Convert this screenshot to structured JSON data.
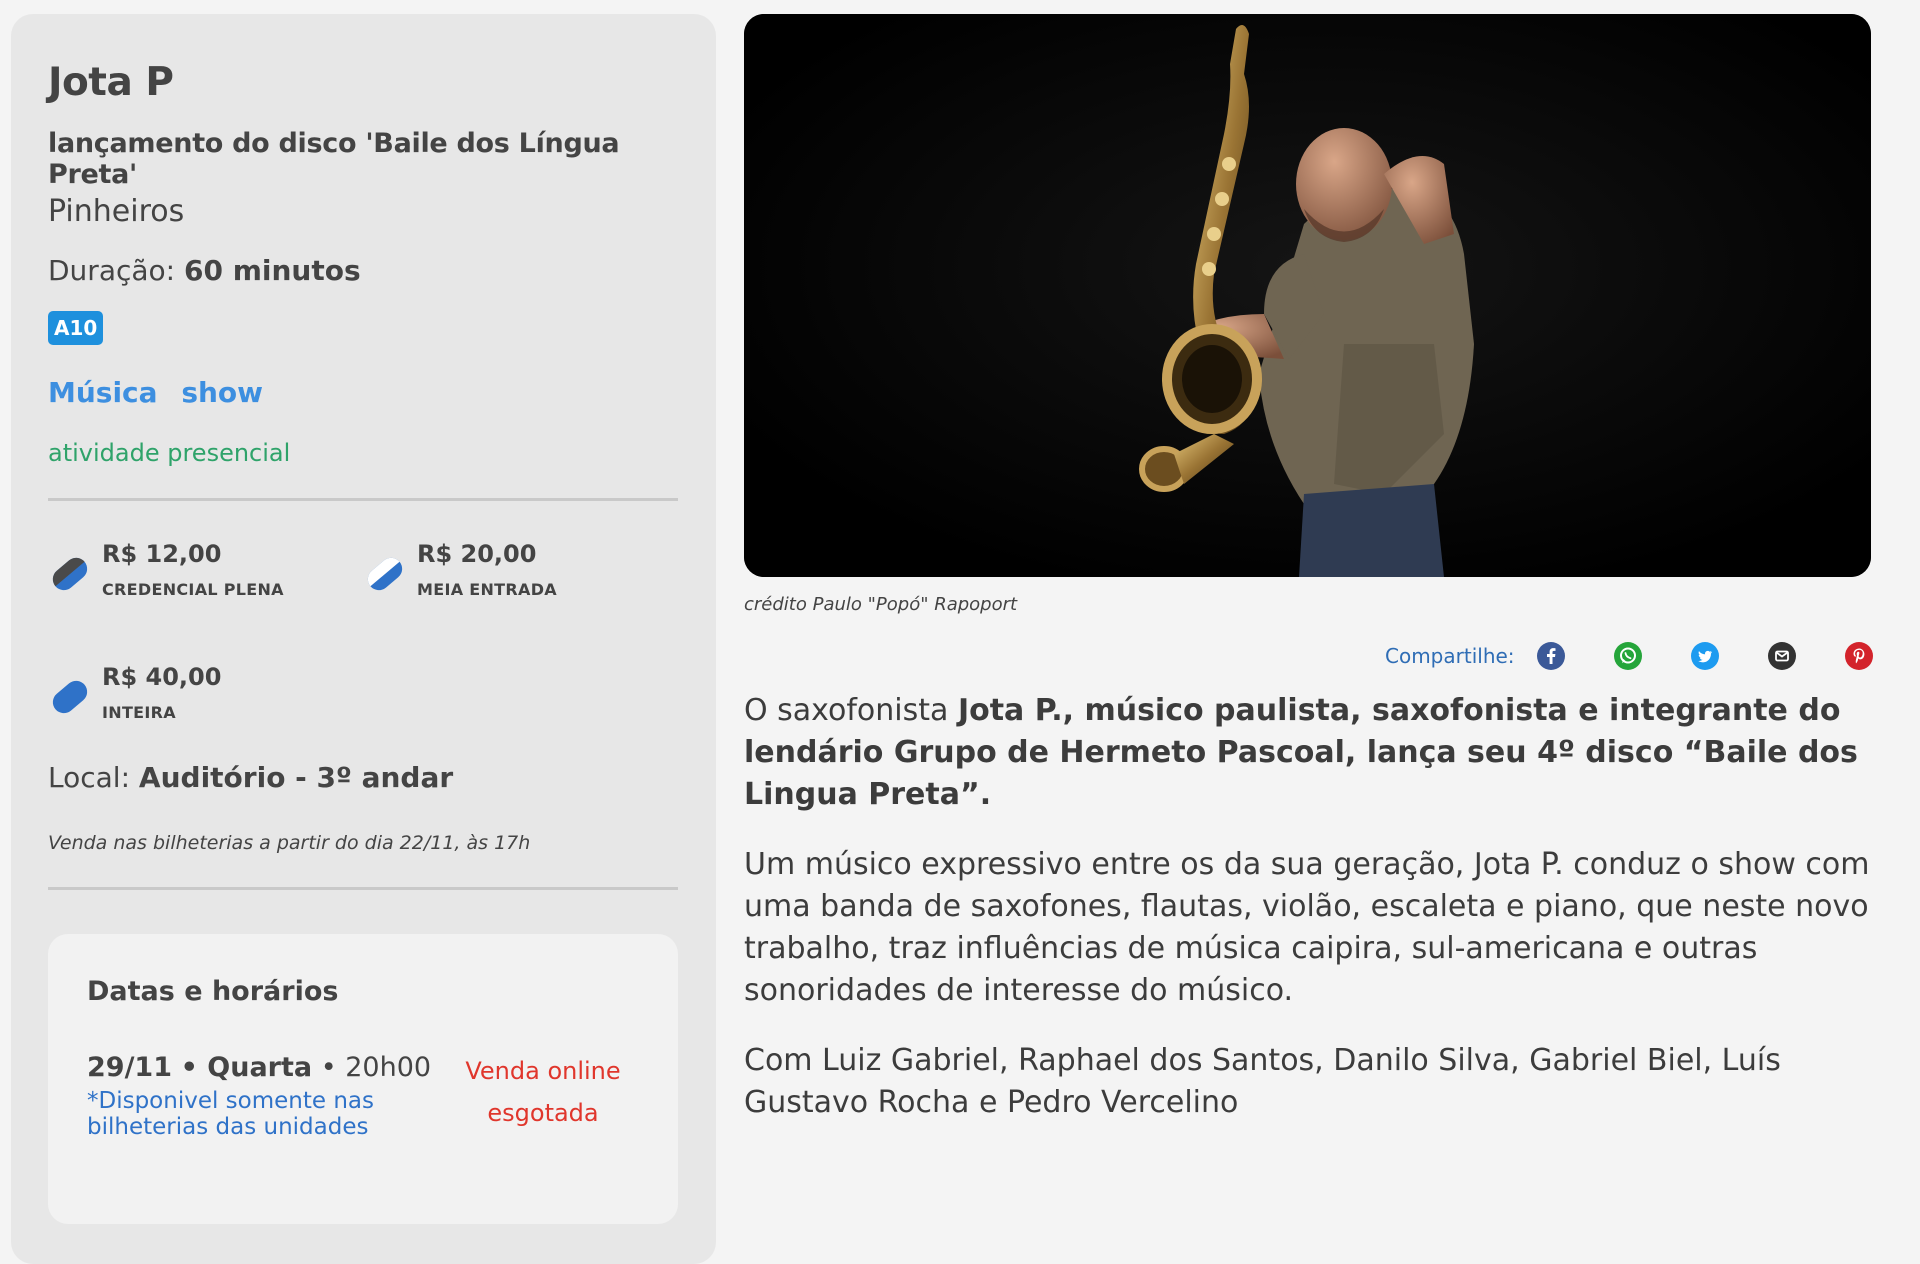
{
  "event": {
    "title": "Jota P",
    "subtitle": "lançamento do disco 'Baile dos Língua Preta'",
    "location": "Pinheiros",
    "duration_label": "Duração:",
    "duration_value": "60 minutos",
    "rating": "A10",
    "tags": [
      "Música",
      "show"
    ],
    "presence": "atividade presencial"
  },
  "prices": [
    {
      "amount": "R$ 12,00",
      "label": "CREDENCIAL PLENA",
      "icon": "credencial-plena-icon",
      "color": "#2f72c8"
    },
    {
      "amount": "R$ 20,00",
      "label": "MEIA ENTRADA",
      "icon": "meia-entrada-icon",
      "color": "#2f72c8"
    },
    {
      "amount": "R$ 40,00",
      "label": "INTEIRA",
      "icon": "inteira-icon",
      "color": "#2f72c8"
    }
  ],
  "venue": {
    "label": "Local:",
    "value": "Auditório - 3º andar",
    "sale_note": "Venda nas bilheterias a partir do dia 22/11, às 17h"
  },
  "schedule": {
    "title": "Datas e horários",
    "sessions": [
      {
        "date": "29/11",
        "weekday": "Quarta",
        "time": "20h00",
        "note": "*Disponivel somente nas bilheterias das unidades",
        "status_line1": "Venda online",
        "status_line2": "esgotada"
      }
    ]
  },
  "media": {
    "photo_alt": "saxophonist-photo",
    "credit": "crédito Paulo \"Popó\" Rapoport"
  },
  "share": {
    "label": "Compartilhe:",
    "networks": [
      {
        "name": "facebook-icon",
        "color": "#3b5998"
      },
      {
        "name": "whatsapp-icon",
        "color": "#25a53a"
      },
      {
        "name": "twitter-icon",
        "color": "#1d9bf0"
      },
      {
        "name": "email-icon",
        "color": "#333333"
      },
      {
        "name": "pinterest-icon",
        "color": "#d3232b"
      }
    ]
  },
  "description": {
    "p1_intro": "O saxofonista ",
    "p1_bold": "Jota P., músico paulista, saxofonista e integrante do lendário Grupo de Hermeto Pascoal, lança seu 4º disco “Baile dos Lingua Preta”.",
    "p2": "Um músico expressivo entre os da sua geração, Jota P. conduz o show com uma banda de saxofones, flautas, violão, escaleta e piano, que neste novo trabalho, traz influências de música caipira, sul-americana e outras sonoridades de interesse do músico.",
    "p3": "Com Luiz Gabriel, Raphael dos Santos, Danilo Silva, Gabriel Biel, Luís Gustavo Rocha e Pedro Vercelino"
  }
}
